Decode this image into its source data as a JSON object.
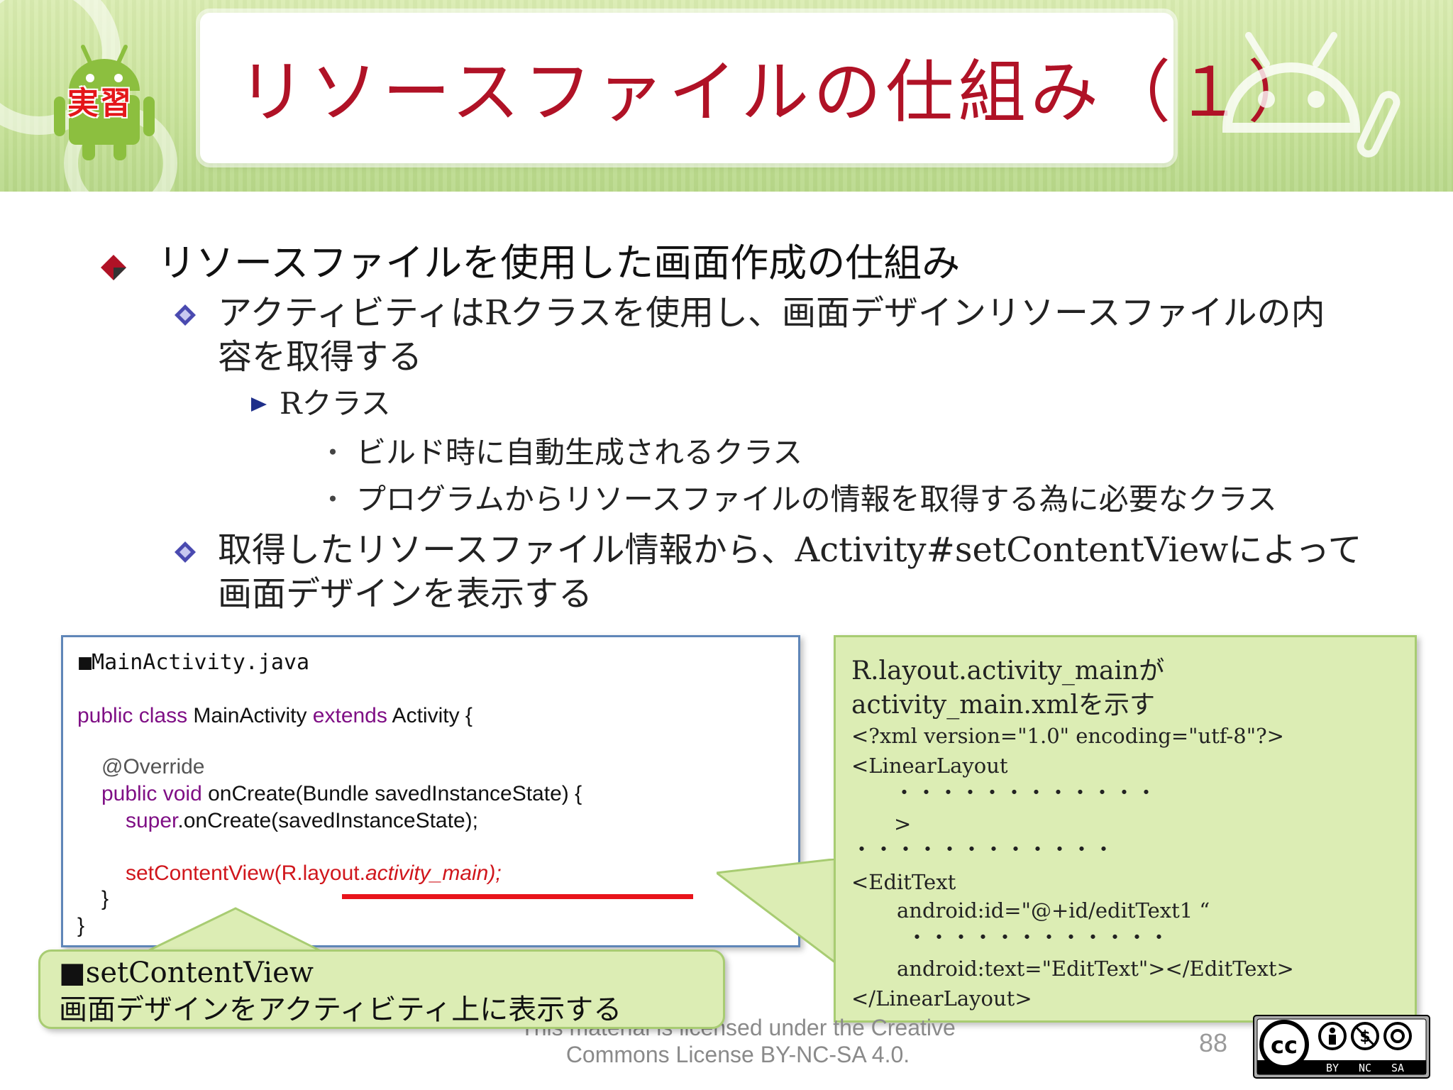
{
  "slide": {
    "title": "リソースファイルの仕組み（１）",
    "badge": "実習"
  },
  "bullets": {
    "level1": "リソースファイルを使用した画面作成の仕組み",
    "level2_a_line1": "アクティビティはRクラスを使用し、画面デザインリソースファイルの内",
    "level2_a_line2": "容を取得する",
    "level3": "Rクラス",
    "level4_marker": "・",
    "level4_a": "ビルド時に自動生成されるクラス",
    "level4_b": "プログラムからリソースファイルの情報を取得する為に必要なクラス",
    "level2_b_line1": "取得したリソースファイル情報から、Activity#setContentViewによって",
    "level2_b_line2": "画面デザインを表示する"
  },
  "code": {
    "filename": "■MainActivity.java",
    "line1_kw1": "public class",
    "line1_name": " MainActivity ",
    "line1_kw2": "extends",
    "line1_rest": " Activity {",
    "annotation": "@Override",
    "line3_kw": "public void",
    "line3_rest": " onCreate(Bundle savedInstanceState) {",
    "line4_kw": "super",
    "line4_rest": ".onCreate(savedInstanceState);",
    "line5_a": "setContentView(R.layout.",
    "line5_b": "activity_main);",
    "close_inner": "}",
    "close_outer": "}"
  },
  "callout_right": {
    "line1": "R.layout.activity_mainが",
    "line2": "activity_main.xmlを示す",
    "line3": "<?xml version=\"1.0\" encoding=\"utf-8\"?>",
    "line4": "<LinearLayout",
    "line5": "・・・・・・・・・・・・",
    "line6": ">",
    "line7": "・・・・・・・・・・・・",
    "line8": "<EditText",
    "line9": "android:id=\"@+id/editText1 “",
    "line10": "・・・・・・・・・・・・",
    "line11": "android:text=\"EditText\"></EditText>",
    "line12": "</LinearLayout>"
  },
  "callout_left": {
    "line1": "■setContentView",
    "line2": "画面デザインをアクティビティ上に表示する"
  },
  "footer": {
    "license_line1": "This material is licensed under the Creative",
    "license_line2": "Commons License BY-NC-SA 4.0.",
    "page_number": "88",
    "cc_labels": [
      "BY",
      "NC",
      "SA"
    ],
    "cc_mark": "cc"
  },
  "colors": {
    "title": "#b01226",
    "keyword": "#7f0f85",
    "highlight": "#d0161c",
    "callout_bg": "#dcedb4",
    "header_bg": "#c9e39a"
  }
}
